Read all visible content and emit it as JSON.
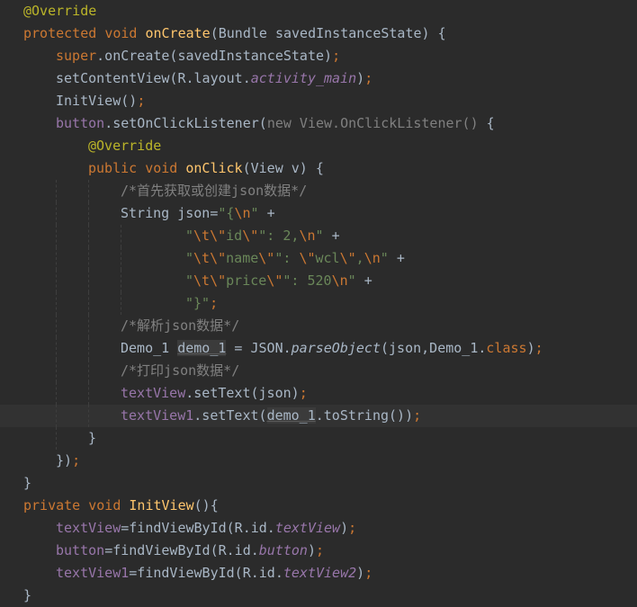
{
  "editor": {
    "lines": [
      [
        [
          "ann",
          "@Override"
        ]
      ],
      [
        [
          "kw",
          "protected "
        ],
        [
          "kw",
          "void "
        ],
        [
          "fn",
          "onCreate"
        ],
        [
          "plain",
          "(Bundle savedInstanceState) {"
        ]
      ],
      [
        [
          "kw",
          "super"
        ],
        [
          "plain",
          ".onCreate(savedInstanceState)"
        ],
        [
          "kw",
          ";"
        ]
      ],
      [
        [
          "plain",
          "setContentView(R.layout."
        ],
        [
          "fld-i",
          "activity_main"
        ],
        [
          "plain",
          ")"
        ],
        [
          "kw",
          ";"
        ]
      ],
      [
        [
          "plain",
          "InitView()"
        ],
        [
          "kw",
          ";"
        ]
      ],
      [
        [
          "fld",
          "button"
        ],
        [
          "plain",
          ".setOnClickListener("
        ],
        [
          "gray",
          "new View.OnClickListener() "
        ],
        [
          "plain",
          "{"
        ]
      ],
      [
        [
          "ann",
          "@Override"
        ]
      ],
      [
        [
          "kw",
          "public "
        ],
        [
          "kw",
          "void "
        ],
        [
          "fn",
          "onClick"
        ],
        [
          "plain",
          "(View v) {"
        ]
      ],
      [
        [
          "cmt",
          "/*首先获取或创建json数据*/"
        ]
      ],
      [
        [
          "plain",
          "String json="
        ],
        [
          "str",
          "\"{"
        ],
        [
          "esc",
          "\\n"
        ],
        [
          "str",
          "\" "
        ],
        [
          "plain",
          "+"
        ]
      ],
      [
        [
          "str",
          "\""
        ],
        [
          "esc",
          "\\t\\\""
        ],
        [
          "str",
          "id"
        ],
        [
          "esc",
          "\\\""
        ],
        [
          "str",
          "\": 2,"
        ],
        [
          "esc",
          "\\n"
        ],
        [
          "str",
          "\" "
        ],
        [
          "plain",
          "+"
        ]
      ],
      [
        [
          "str",
          "\""
        ],
        [
          "esc",
          "\\t\\\""
        ],
        [
          "str",
          "name"
        ],
        [
          "esc",
          "\\\""
        ],
        [
          "str",
          "\": "
        ],
        [
          "esc",
          "\\\""
        ],
        [
          "str",
          "wcl"
        ],
        [
          "esc",
          "\\\""
        ],
        [
          "str",
          ","
        ],
        [
          "esc",
          "\\n"
        ],
        [
          "str",
          "\" "
        ],
        [
          "plain",
          "+"
        ]
      ],
      [
        [
          "str",
          "\""
        ],
        [
          "esc",
          "\\t\\\""
        ],
        [
          "str",
          "price"
        ],
        [
          "esc",
          "\\\""
        ],
        [
          "str",
          "\": 520"
        ],
        [
          "esc",
          "\\n"
        ],
        [
          "str",
          "\" "
        ],
        [
          "plain",
          "+"
        ]
      ],
      [
        [
          "str",
          "\"}\""
        ],
        [
          "kw",
          ";"
        ]
      ],
      [
        [
          "cmt",
          "/*解析json数据*/"
        ]
      ],
      [
        [
          "plain",
          "Demo_1 "
        ],
        [
          "hl2",
          "demo_1"
        ],
        [
          "plain",
          " = JSON."
        ],
        [
          "it",
          "parseObject"
        ],
        [
          "plain",
          "(json,Demo_1."
        ],
        [
          "kw",
          "class"
        ],
        [
          "plain",
          ")"
        ],
        [
          "kw",
          ";"
        ]
      ],
      [
        [
          "cmt",
          "/*打印json数据*/"
        ]
      ],
      [
        [
          "fld",
          "textView"
        ],
        [
          "plain",
          ".setText(json)"
        ],
        [
          "kw",
          ";"
        ]
      ],
      [
        [
          "fld",
          "textView1"
        ],
        [
          "plain",
          ".setText("
        ],
        [
          "hl2",
          "demo_1"
        ],
        [
          "plain",
          ".toString())"
        ],
        [
          "kw",
          ";"
        ]
      ],
      [
        [
          "plain",
          "}"
        ]
      ],
      [
        [
          "plain",
          "})"
        ],
        [
          "kw",
          ";"
        ]
      ],
      [
        [
          "plain",
          "}"
        ]
      ],
      [
        [
          "kw",
          "private "
        ],
        [
          "kw",
          "void "
        ],
        [
          "fn",
          "InitView"
        ],
        [
          "plain",
          "(){"
        ]
      ],
      [
        [
          "fld",
          "textView"
        ],
        [
          "plain",
          "=findViewById(R.id."
        ],
        [
          "fld-i",
          "textView"
        ],
        [
          "plain",
          ")"
        ],
        [
          "kw",
          ";"
        ]
      ],
      [
        [
          "fld",
          "button"
        ],
        [
          "plain",
          "=findViewById(R.id."
        ],
        [
          "fld-i",
          "button"
        ],
        [
          "plain",
          ")"
        ],
        [
          "kw",
          ";"
        ]
      ],
      [
        [
          "fld",
          "textView1"
        ],
        [
          "plain",
          "=findViewById(R.id."
        ],
        [
          "fld-i",
          "textView2"
        ],
        [
          "plain",
          ")"
        ],
        [
          "kw",
          ";"
        ]
      ],
      [
        [
          "plain",
          "}"
        ]
      ]
    ]
  }
}
